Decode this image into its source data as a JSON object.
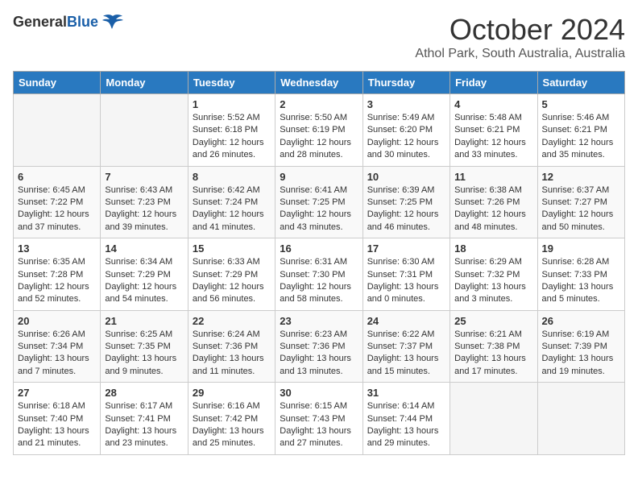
{
  "header": {
    "logo_general": "General",
    "logo_blue": "Blue",
    "title": "October 2024",
    "location": "Athol Park, South Australia, Australia"
  },
  "days_of_week": [
    "Sunday",
    "Monday",
    "Tuesday",
    "Wednesday",
    "Thursday",
    "Friday",
    "Saturday"
  ],
  "weeks": [
    [
      {
        "day": "",
        "info": ""
      },
      {
        "day": "",
        "info": ""
      },
      {
        "day": "1",
        "info": "Sunrise: 5:52 AM\nSunset: 6:18 PM\nDaylight: 12 hours\nand 26 minutes."
      },
      {
        "day": "2",
        "info": "Sunrise: 5:50 AM\nSunset: 6:19 PM\nDaylight: 12 hours\nand 28 minutes."
      },
      {
        "day": "3",
        "info": "Sunrise: 5:49 AM\nSunset: 6:20 PM\nDaylight: 12 hours\nand 30 minutes."
      },
      {
        "day": "4",
        "info": "Sunrise: 5:48 AM\nSunset: 6:21 PM\nDaylight: 12 hours\nand 33 minutes."
      },
      {
        "day": "5",
        "info": "Sunrise: 5:46 AM\nSunset: 6:21 PM\nDaylight: 12 hours\nand 35 minutes."
      }
    ],
    [
      {
        "day": "6",
        "info": "Sunrise: 6:45 AM\nSunset: 7:22 PM\nDaylight: 12 hours\nand 37 minutes."
      },
      {
        "day": "7",
        "info": "Sunrise: 6:43 AM\nSunset: 7:23 PM\nDaylight: 12 hours\nand 39 minutes."
      },
      {
        "day": "8",
        "info": "Sunrise: 6:42 AM\nSunset: 7:24 PM\nDaylight: 12 hours\nand 41 minutes."
      },
      {
        "day": "9",
        "info": "Sunrise: 6:41 AM\nSunset: 7:25 PM\nDaylight: 12 hours\nand 43 minutes."
      },
      {
        "day": "10",
        "info": "Sunrise: 6:39 AM\nSunset: 7:25 PM\nDaylight: 12 hours\nand 46 minutes."
      },
      {
        "day": "11",
        "info": "Sunrise: 6:38 AM\nSunset: 7:26 PM\nDaylight: 12 hours\nand 48 minutes."
      },
      {
        "day": "12",
        "info": "Sunrise: 6:37 AM\nSunset: 7:27 PM\nDaylight: 12 hours\nand 50 minutes."
      }
    ],
    [
      {
        "day": "13",
        "info": "Sunrise: 6:35 AM\nSunset: 7:28 PM\nDaylight: 12 hours\nand 52 minutes."
      },
      {
        "day": "14",
        "info": "Sunrise: 6:34 AM\nSunset: 7:29 PM\nDaylight: 12 hours\nand 54 minutes."
      },
      {
        "day": "15",
        "info": "Sunrise: 6:33 AM\nSunset: 7:29 PM\nDaylight: 12 hours\nand 56 minutes."
      },
      {
        "day": "16",
        "info": "Sunrise: 6:31 AM\nSunset: 7:30 PM\nDaylight: 12 hours\nand 58 minutes."
      },
      {
        "day": "17",
        "info": "Sunrise: 6:30 AM\nSunset: 7:31 PM\nDaylight: 13 hours\nand 0 minutes."
      },
      {
        "day": "18",
        "info": "Sunrise: 6:29 AM\nSunset: 7:32 PM\nDaylight: 13 hours\nand 3 minutes."
      },
      {
        "day": "19",
        "info": "Sunrise: 6:28 AM\nSunset: 7:33 PM\nDaylight: 13 hours\nand 5 minutes."
      }
    ],
    [
      {
        "day": "20",
        "info": "Sunrise: 6:26 AM\nSunset: 7:34 PM\nDaylight: 13 hours\nand 7 minutes."
      },
      {
        "day": "21",
        "info": "Sunrise: 6:25 AM\nSunset: 7:35 PM\nDaylight: 13 hours\nand 9 minutes."
      },
      {
        "day": "22",
        "info": "Sunrise: 6:24 AM\nSunset: 7:36 PM\nDaylight: 13 hours\nand 11 minutes."
      },
      {
        "day": "23",
        "info": "Sunrise: 6:23 AM\nSunset: 7:36 PM\nDaylight: 13 hours\nand 13 minutes."
      },
      {
        "day": "24",
        "info": "Sunrise: 6:22 AM\nSunset: 7:37 PM\nDaylight: 13 hours\nand 15 minutes."
      },
      {
        "day": "25",
        "info": "Sunrise: 6:21 AM\nSunset: 7:38 PM\nDaylight: 13 hours\nand 17 minutes."
      },
      {
        "day": "26",
        "info": "Sunrise: 6:19 AM\nSunset: 7:39 PM\nDaylight: 13 hours\nand 19 minutes."
      }
    ],
    [
      {
        "day": "27",
        "info": "Sunrise: 6:18 AM\nSunset: 7:40 PM\nDaylight: 13 hours\nand 21 minutes."
      },
      {
        "day": "28",
        "info": "Sunrise: 6:17 AM\nSunset: 7:41 PM\nDaylight: 13 hours\nand 23 minutes."
      },
      {
        "day": "29",
        "info": "Sunrise: 6:16 AM\nSunset: 7:42 PM\nDaylight: 13 hours\nand 25 minutes."
      },
      {
        "day": "30",
        "info": "Sunrise: 6:15 AM\nSunset: 7:43 PM\nDaylight: 13 hours\nand 27 minutes."
      },
      {
        "day": "31",
        "info": "Sunrise: 6:14 AM\nSunset: 7:44 PM\nDaylight: 13 hours\nand 29 minutes."
      },
      {
        "day": "",
        "info": ""
      },
      {
        "day": "",
        "info": ""
      }
    ]
  ]
}
